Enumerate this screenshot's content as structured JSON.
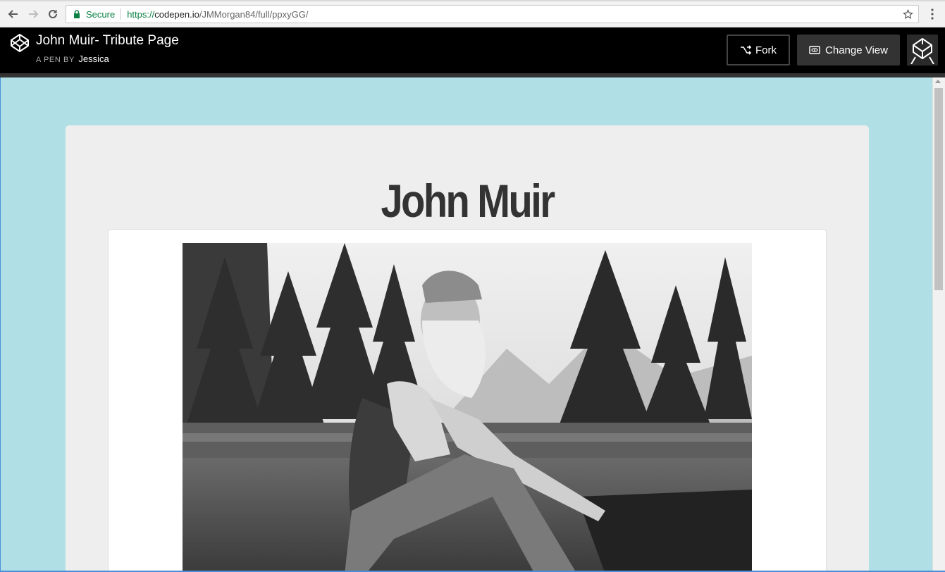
{
  "browser": {
    "secure_label": "Secure",
    "url_scheme": "https://",
    "url_host": "codepen.io",
    "url_path": "/JMMorgan84/full/ppxyGG/"
  },
  "codepen": {
    "pen_title": "John Muir- Tribute Page",
    "by_label": "A PEN BY",
    "author": "Jessica",
    "fork_label": "Fork",
    "change_view_label": "Change View"
  },
  "page": {
    "heading": "John Muir",
    "image_alt": "Black and white photograph of John Muir seated beside a mountain lake with pine trees"
  },
  "colors": {
    "page_bg": "#b0dfe5",
    "card_bg": "#eeeeee",
    "header_bg": "#000000",
    "secure_green": "#0b8043"
  }
}
